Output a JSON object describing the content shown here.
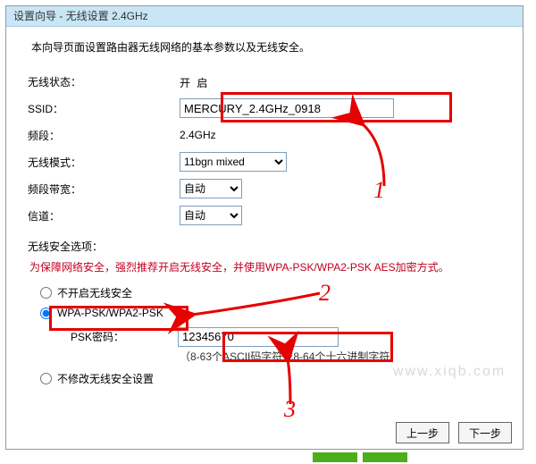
{
  "title": "设置向导 - 无线设置 2.4GHz",
  "intro": "本向导页面设置路由器无线网络的基本参数以及无线安全。",
  "labels": {
    "status": "无线状态：",
    "ssid": "SSID：",
    "band": "频段：",
    "mode": "无线模式：",
    "bandwidth": "频段带宽：",
    "channel": "信道：",
    "security_title": "无线安全选项：",
    "psk": "PSK密码："
  },
  "values": {
    "status": "开 启",
    "ssid": "MERCURY_2.4GHz_0918",
    "band": "2.4GHz",
    "mode": "11bgn mixed",
    "bandwidth": "自动",
    "channel": "自动",
    "psk": "12345670"
  },
  "warning": "为保障网络安全，强烈推荐开启无线安全，并使用WPA-PSK/WPA2-PSK AES加密方式。",
  "options": {
    "none": "不开启无线安全",
    "wpa": "WPA-PSK/WPA2-PSK",
    "keep": "不修改无线安全设置"
  },
  "hint": "（8-63个ASCII码字符或8-64个十六进制字符）",
  "buttons": {
    "prev": "上一步",
    "next": "下一步"
  },
  "annotations": {
    "n1": "1",
    "n2": "2",
    "n3": "3"
  },
  "watermark": "www.xiqb.com"
}
